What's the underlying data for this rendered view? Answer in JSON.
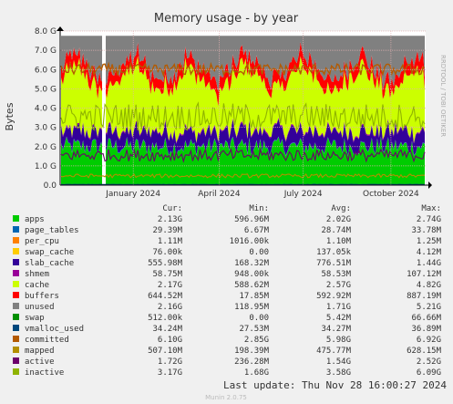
{
  "chart_data": {
    "type": "area",
    "title": "Memory usage - by year",
    "ylabel": "Bytes",
    "side_label": "RRDTOOL / TOBI OETIKER",
    "ylim": [
      0,
      8.0
    ],
    "y_unit": "G",
    "y_ticks": [
      "0.0",
      "1.0 G",
      "2.0 G",
      "3.0 G",
      "4.0 G",
      "5.0 G",
      "6.0 G",
      "7.0 G",
      "8.0 G"
    ],
    "x_ticks": [
      "January 2024",
      "April 2024",
      "July 2024",
      "October 2024"
    ],
    "grid": true,
    "stack_order": [
      "apps",
      "page_tables",
      "per_cpu",
      "swap_cache",
      "slab_cache",
      "shmem",
      "cache",
      "buffers",
      "unused"
    ],
    "lines": [
      "swap",
      "vmalloc_used",
      "committed",
      "mapped",
      "active",
      "inactive"
    ],
    "approx_cur_G": {
      "apps": 2.13,
      "page_tables": 0.03,
      "per_cpu": 0.001,
      "swap_cache": 0.0001,
      "slab_cache": 0.56,
      "shmem": 0.06,
      "cache": 2.17,
      "buffers": 0.64,
      "unused": 2.16,
      "swap": 0.0005,
      "vmalloc_used": 0.034,
      "committed": 6.1,
      "mapped": 0.51,
      "active": 1.72,
      "inactive": 3.17
    }
  },
  "legend": {
    "headers": {
      "cur": "Cur:",
      "min": "Min:",
      "avg": "Avg:",
      "max": "Max:"
    },
    "rows": [
      {
        "name": "apps",
        "color": "#00cc00",
        "cur": "2.13G",
        "min": "596.96M",
        "avg": "2.02G",
        "max": "2.74G"
      },
      {
        "name": "page_tables",
        "color": "#0066b3",
        "cur": "29.39M",
        "min": "6.67M",
        "avg": "28.74M",
        "max": "33.78M"
      },
      {
        "name": "per_cpu",
        "color": "#ff8000",
        "cur": "1.11M",
        "min": "1016.00k",
        "avg": "1.10M",
        "max": "1.25M"
      },
      {
        "name": "swap_cache",
        "color": "#ffcc00",
        "cur": "76.00k",
        "min": "0.00",
        "avg": "137.05k",
        "max": "4.12M"
      },
      {
        "name": "slab_cache",
        "color": "#330099",
        "cur": "555.98M",
        "min": "168.32M",
        "avg": "776.51M",
        "max": "1.44G"
      },
      {
        "name": "shmem",
        "color": "#990099",
        "cur": "58.75M",
        "min": "948.00k",
        "avg": "58.53M",
        "max": "107.12M"
      },
      {
        "name": "cache",
        "color": "#ccff00",
        "cur": "2.17G",
        "min": "588.62M",
        "avg": "2.57G",
        "max": "4.82G"
      },
      {
        "name": "buffers",
        "color": "#ff0000",
        "cur": "644.52M",
        "min": "17.85M",
        "avg": "592.92M",
        "max": "887.19M"
      },
      {
        "name": "unused",
        "color": "#808080",
        "cur": "2.16G",
        "min": "118.95M",
        "avg": "1.71G",
        "max": "5.21G"
      },
      {
        "name": "swap",
        "color": "#008f00",
        "cur": "512.00k",
        "min": "0.00",
        "avg": "5.42M",
        "max": "66.66M"
      },
      {
        "name": "vmalloc_used",
        "color": "#00487d",
        "cur": "34.24M",
        "min": "27.53M",
        "avg": "34.27M",
        "max": "36.89M"
      },
      {
        "name": "committed",
        "color": "#b35a00",
        "cur": "6.10G",
        "min": "2.85G",
        "avg": "5.98G",
        "max": "6.92G"
      },
      {
        "name": "mapped",
        "color": "#b38f00",
        "cur": "507.10M",
        "min": "198.39M",
        "avg": "475.77M",
        "max": "628.15M"
      },
      {
        "name": "active",
        "color": "#6b006b",
        "cur": "1.72G",
        "min": "236.28M",
        "avg": "1.54G",
        "max": "2.52G"
      },
      {
        "name": "inactive",
        "color": "#8fb300",
        "cur": "3.17G",
        "min": "1.68G",
        "avg": "3.58G",
        "max": "6.09G"
      }
    ]
  },
  "footer": {
    "last_update": "Last update: Thu Nov 28 16:00:27 2024",
    "version": "Munin 2.0.75"
  }
}
